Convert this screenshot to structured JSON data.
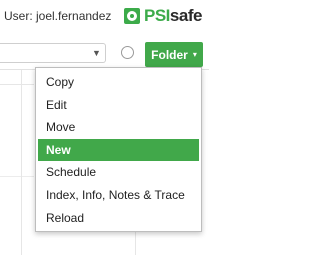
{
  "header": {
    "user_label": "User: joel.fernandez",
    "logo_psi": "PSI",
    "logo_safe": "safe"
  },
  "toolbar": {
    "search_value": "",
    "folder_button_label": "Folder",
    "folder_caret": "▾"
  },
  "folder_menu": {
    "items": [
      {
        "label": "Copy"
      },
      {
        "label": "Edit"
      },
      {
        "label": "Move"
      },
      {
        "label": "New",
        "active": true
      },
      {
        "label": "Schedule"
      },
      {
        "label": "Index, Info, Notes & Trace"
      },
      {
        "label": "Reload"
      }
    ]
  },
  "colors": {
    "accent": "#41a84a",
    "brand_green": "#3cab4a"
  },
  "icons": {
    "logo": "psisafe-logo-icon",
    "dropdown": "chevron-down-icon",
    "radio": "radio-button-icon"
  }
}
